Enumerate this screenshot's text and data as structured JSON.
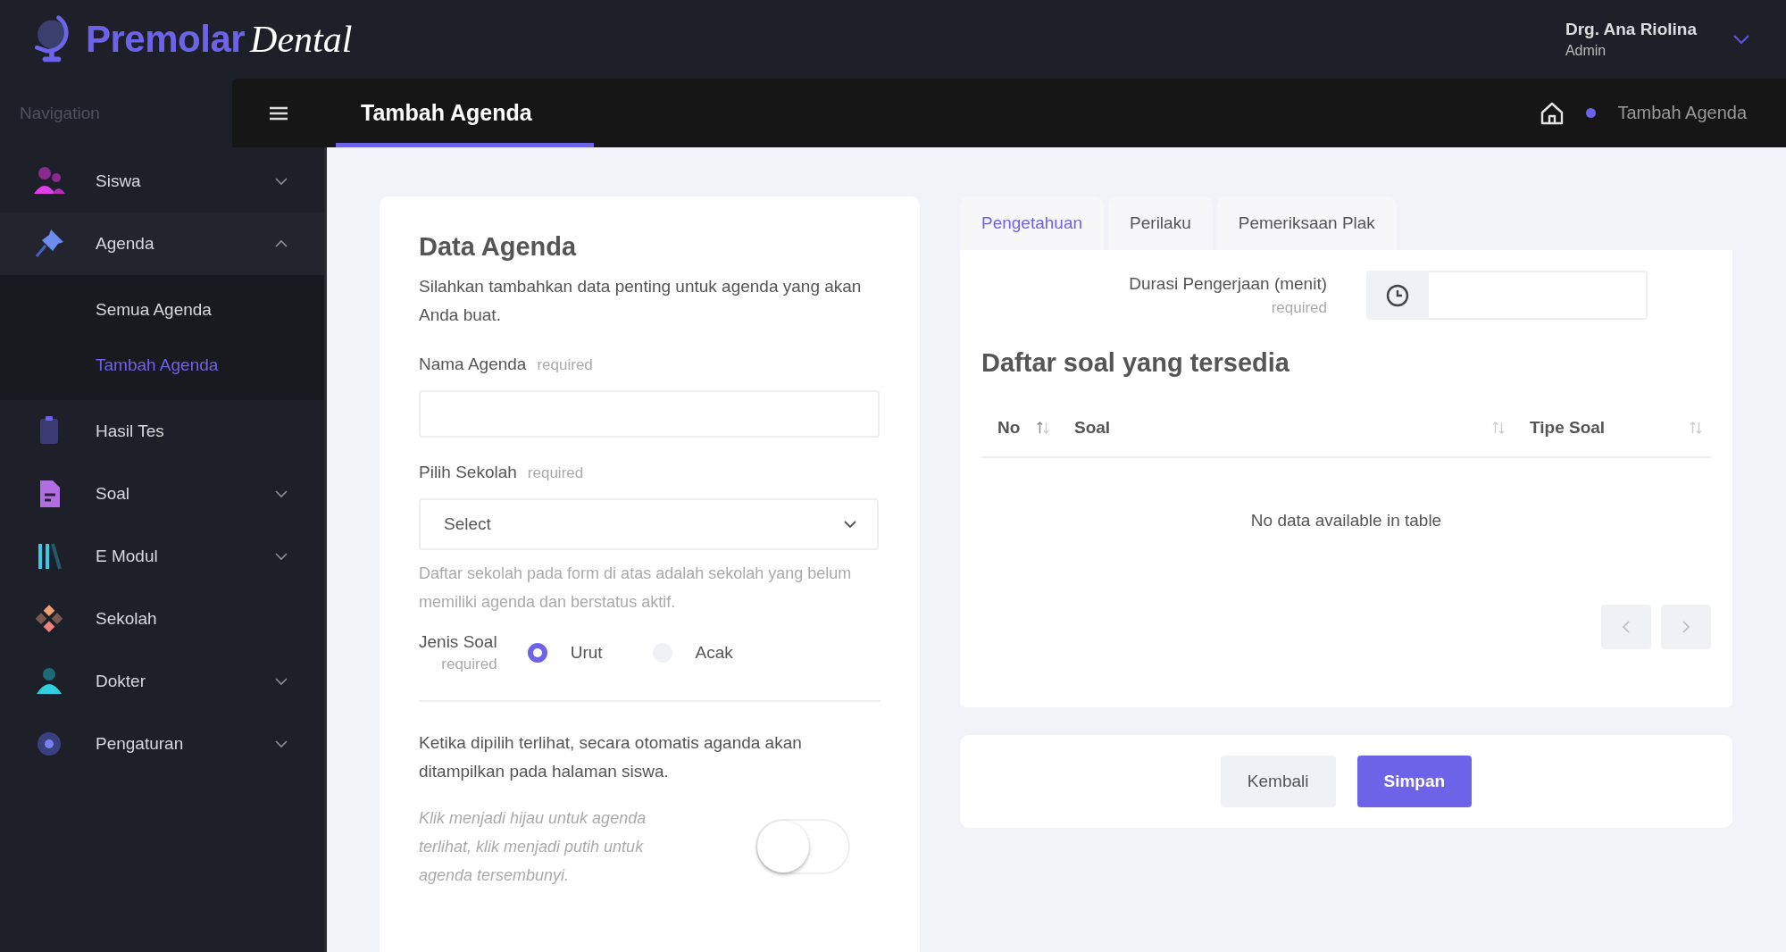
{
  "brand": {
    "name": "Premolar",
    "script": "Dental"
  },
  "user": {
    "name": "Drg. Ana Riolina",
    "role": "Admin"
  },
  "navbar": {
    "page_title": "Tambah Agenda",
    "breadcrumb": "Tambah Agenda"
  },
  "sidebar": {
    "heading": "Navigation",
    "items": [
      {
        "label": "Siswa",
        "kind": "group",
        "expanded": false
      },
      {
        "label": "Agenda",
        "kind": "group",
        "expanded": true,
        "children": [
          {
            "label": "Semua Agenda",
            "selected": false
          },
          {
            "label": "Tambah Agenda",
            "selected": true
          }
        ]
      },
      {
        "label": "Hasil Tes",
        "kind": "link"
      },
      {
        "label": "Soal",
        "kind": "group",
        "expanded": false
      },
      {
        "label": "E Modul",
        "kind": "group",
        "expanded": false
      },
      {
        "label": "Sekolah",
        "kind": "link"
      },
      {
        "label": "Dokter",
        "kind": "group",
        "expanded": false
      },
      {
        "label": "Pengaturan",
        "kind": "group",
        "expanded": false
      }
    ]
  },
  "form": {
    "title": "Data Agenda",
    "intro": "Silahkan tambahkan data penting untuk agenda yang akan Anda buat.",
    "name_field": {
      "label": "Nama Agenda",
      "required": "required"
    },
    "school_field": {
      "label": "Pilih Sekolah",
      "required": "required",
      "value": "Select",
      "hint": "Daftar sekolah pada form di atas adalah sekolah yang belum memiliki agenda dan berstatus aktif."
    },
    "type_field": {
      "label": "Jenis Soal",
      "required": "required",
      "options": [
        {
          "label": "Urut",
          "selected": true
        },
        {
          "label": "Acak",
          "selected": false
        }
      ]
    },
    "visibility_info": "Ketika dipilih terlihat, secara otomatis aganda akan ditampilkan pada halaman siswa.",
    "visibility_note": "Klik menjadi hijau untuk agenda terlihat, klik menjadi putih untuk agenda tersembunyi.",
    "visible": false
  },
  "tabs": [
    {
      "label": "Pengetahuan",
      "selected": true
    },
    {
      "label": "Perilaku",
      "selected": false
    },
    {
      "label": "Pemeriksaan Plak",
      "selected": false
    }
  ],
  "duration": {
    "label": "Durasi Pengerjaan (menit)",
    "required": "required"
  },
  "table": {
    "title": "Daftar soal yang tersedia",
    "columns": [
      {
        "label": "No",
        "sorted": true
      },
      {
        "label": "Soal",
        "sorted": false
      },
      {
        "label": "Tipe Soal",
        "sorted": false
      }
    ],
    "empty": "No data available in table",
    "pagination": {
      "previous_disabled": true,
      "next_disabled": true
    }
  },
  "buttons": [
    {
      "label": "Kembali",
      "kind": "secondary"
    },
    {
      "label": "Simpan",
      "kind": "primary"
    }
  ]
}
